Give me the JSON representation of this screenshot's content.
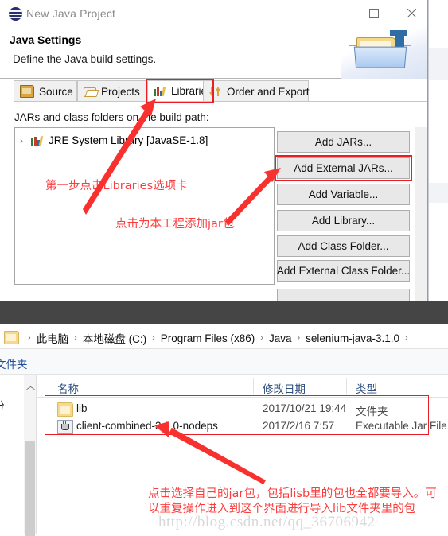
{
  "wizard": {
    "title": "New Java Project",
    "app_icon": "eclipse-icon",
    "window_controls": {
      "minimize": "–",
      "maximize": "▢",
      "close": "✕"
    },
    "banner": {
      "heading": "Java Settings",
      "subheading": "Define the Java build settings."
    },
    "tabs": [
      {
        "label": "Source",
        "icon": "source-folder-icon",
        "selected": false
      },
      {
        "label": "Projects",
        "icon": "open-folder-icon",
        "selected": false
      },
      {
        "label": "Libraries",
        "icon": "books-icon",
        "selected": true
      },
      {
        "label": "Order and Export",
        "icon": "up-down-arrows-icon",
        "selected": false
      }
    ],
    "panel_label": "JARs and class folders on the build path:",
    "tree": [
      {
        "expander": "›",
        "icon": "books-icon",
        "label": "JRE System Library [JavaSE-1.8]"
      }
    ],
    "buttons": [
      "Add JARs...",
      "Add External JARs...",
      "Add Variable...",
      "Add Library...",
      "Add Class Folder...",
      "Add External Class Folder..."
    ]
  },
  "annotations": {
    "step1": "第一步点击Libraries选项卡",
    "step2": "点击为本工程添加jar包",
    "step3": "点击选择自己的jar包，包括lisb里的包也全都要导入。可以重复操作进入到这个界面进行导入lib文件夹里的包",
    "highlight_color": "#ec1c24",
    "text_color": "#fc3d3d"
  },
  "watermark": "http://blog.csdn.net/qq_36706942",
  "explorer": {
    "breadcrumbs": [
      "此电脑",
      "本地磁盘 (C:)",
      "Program Files (x86)",
      "Java",
      "selenium-java-3.1.0"
    ],
    "breadcrumb_separator": "›",
    "toolbar_text": "文件夹",
    "nav_pane_text": "份",
    "columns": [
      "名称",
      "修改日期",
      "类型"
    ],
    "rows": [
      {
        "icon": "folder-icon",
        "name": "lib",
        "date": "2017/10/21 19:44",
        "type": "文件夹"
      },
      {
        "icon": "jar-file-icon",
        "name": "client-combined-3.1.0-nodeps",
        "date": "2017/2/16 7:57",
        "type": "Executable Jar File"
      }
    ]
  }
}
